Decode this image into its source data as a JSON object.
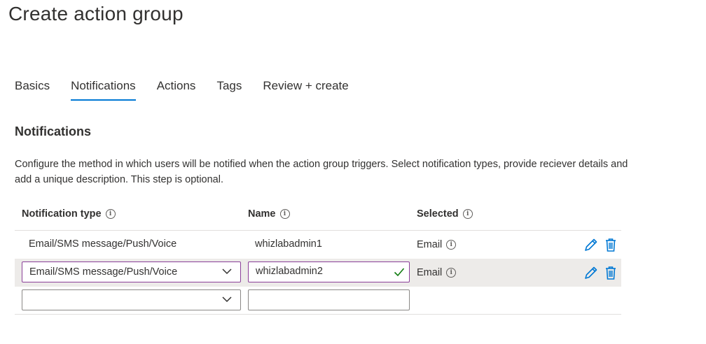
{
  "page": {
    "title": "Create action group"
  },
  "tabs": [
    {
      "label": "Basics",
      "active": false
    },
    {
      "label": "Notifications",
      "active": true
    },
    {
      "label": "Actions",
      "active": false
    },
    {
      "label": "Tags",
      "active": false
    },
    {
      "label": "Review + create",
      "active": false
    }
  ],
  "section": {
    "title": "Notifications",
    "description": "Configure the method in which users will be notified when the action group triggers. Select notification types, provide reciever details and add a unique description. This step is optional."
  },
  "table": {
    "headers": {
      "type": "Notification type",
      "name": "Name",
      "selected": "Selected"
    },
    "rows": [
      {
        "type": "Email/SMS message/Push/Voice",
        "name": "whizlabadmin1",
        "selected": "Email"
      },
      {
        "type": "Email/SMS message/Push/Voice",
        "name": "whizlabadmin2",
        "selected": "Email"
      }
    ],
    "new_row": {
      "type": "",
      "name": ""
    }
  },
  "icons": {
    "info": "info-circle-icon",
    "edit": "pencil-icon",
    "delete": "trash-icon",
    "chevron": "chevron-down-icon",
    "valid": "checkmark-icon"
  },
  "colors": {
    "accent": "#0078d4",
    "focus_border": "#8a3f98",
    "valid": "#107c10",
    "selected_row": "#edebe9"
  }
}
